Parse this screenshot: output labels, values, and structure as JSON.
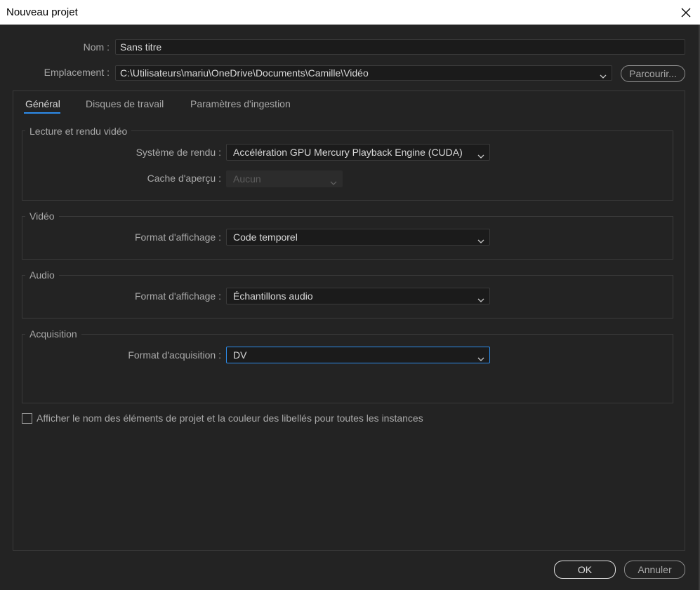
{
  "window": {
    "title": "Nouveau projet"
  },
  "form": {
    "name_label": "Nom :",
    "name_value": "Sans titre",
    "location_label": "Emplacement :",
    "location_value": "C:\\Utilisateurs\\mariu\\OneDrive\\Documents\\Camille\\Vidéo",
    "browse_label": "Parcourir..."
  },
  "tabs": [
    {
      "label": "Général",
      "active": true
    },
    {
      "label": "Disques de travail",
      "active": false
    },
    {
      "label": "Paramètres d'ingestion",
      "active": false
    }
  ],
  "playback": {
    "title": "Lecture et rendu vidéo",
    "renderer_label": "Système de rendu :",
    "renderer_value": "Accélération GPU Mercury Playback Engine (CUDA)",
    "cache_label": "Cache d'aperçu :",
    "cache_value": "Aucun"
  },
  "video": {
    "title": "Vidéo",
    "display_label": "Format d'affichage :",
    "display_value": "Code temporel"
  },
  "audio": {
    "title": "Audio",
    "display_label": "Format d'affichage :",
    "display_value": "Échantillons audio"
  },
  "capture": {
    "title": "Acquisition",
    "format_label": "Format d'acquisition :",
    "format_value": "DV"
  },
  "checkbox": {
    "label": "Afficher le nom des éléments de projet et la couleur des libellés pour toutes les instances",
    "checked": false
  },
  "footer": {
    "ok_label": "OK",
    "cancel_label": "Annuler"
  },
  "colors": {
    "accent": "#2d8ceb",
    "background": "#232323"
  }
}
